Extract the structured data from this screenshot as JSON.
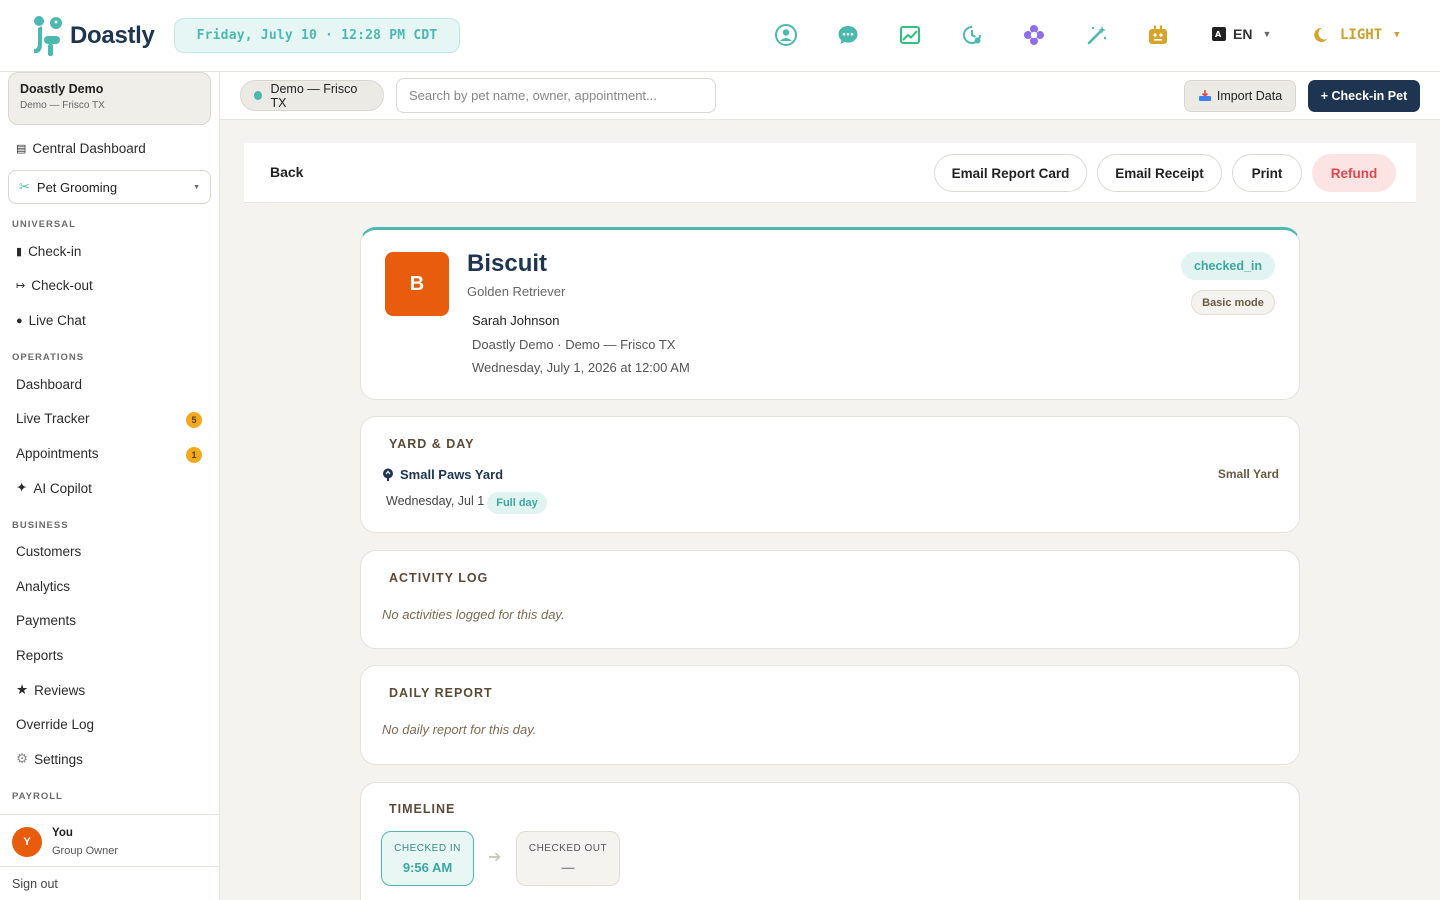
{
  "app": {
    "name": "Doastly"
  },
  "header": {
    "datetime": "Friday, July 10 · 12:28 PM CDT",
    "language": "EN",
    "theme": "LIGHT",
    "icons": [
      "profile-icon",
      "chat-icon",
      "image-icon",
      "clock-icon",
      "flower-icon",
      "magic-wand-icon",
      "robot-icon"
    ]
  },
  "sidebar": {
    "org_name": "Doastly Demo",
    "org_sub": "Demo — Frisco TX",
    "central_dashboard": "Central Dashboard",
    "service": "Pet Grooming",
    "sections": {
      "universal": "UNIVERSAL",
      "operations": "OPERATIONS",
      "business": "BUSINESS",
      "payroll": "PAYROLL"
    },
    "items": {
      "checkin": "Check-in",
      "checkout": "Check-out",
      "livechat": "Live Chat",
      "dashboard": "Dashboard",
      "livetracker": "Live Tracker",
      "livetracker_count": "5",
      "appointments": "Appointments",
      "appointments_count": "1",
      "copilot": "AI Copilot",
      "customers": "Customers",
      "analytics": "Analytics",
      "payments": "Payments",
      "reports": "Reports",
      "reviews": "Reviews",
      "override": "Override Log",
      "settings": "Settings"
    },
    "user": {
      "initial": "Y",
      "name": "You",
      "role": "Group Owner"
    },
    "signout": "Sign out"
  },
  "subbar": {
    "location": "Demo — Frisco TX",
    "search_placeholder": "Search by pet name, owner, appointment...",
    "import_label": "Import Data",
    "checkin_label": "+ Check-in Pet"
  },
  "actions": {
    "back": "Back",
    "email_report": "Email Report Card",
    "email_receipt": "Email Receipt",
    "print": "Print",
    "refund": "Refund"
  },
  "pet": {
    "initial": "B",
    "name": "Biscuit",
    "breed": "Golden Retriever",
    "owner": "Sarah Johnson",
    "location": "Doastly Demo · Demo — Frisco TX",
    "date": "Wednesday, July 1, 2026 at 12:00 AM",
    "status": "checked_in",
    "mode": "Basic mode"
  },
  "yard": {
    "title": "YARD & DAY",
    "name": "Small Paws Yard",
    "type": "Small Yard",
    "date": "Wednesday, Jul 1",
    "duration": "Full day"
  },
  "activity": {
    "title": "ACTIVITY LOG",
    "empty": "No activities logged for this day."
  },
  "daily": {
    "title": "DAILY REPORT",
    "empty": "No daily report for this day."
  },
  "timeline": {
    "title": "TIMELINE",
    "checked_in_label": "CHECKED IN",
    "checked_in_value": "9:56 AM",
    "checked_out_label": "CHECKED OUT",
    "checked_out_value": "—"
  },
  "colors": {
    "accent": "#4cb9b0",
    "navy": "#1d3550",
    "orange": "#e85c0d",
    "refund": "#e0474c"
  }
}
